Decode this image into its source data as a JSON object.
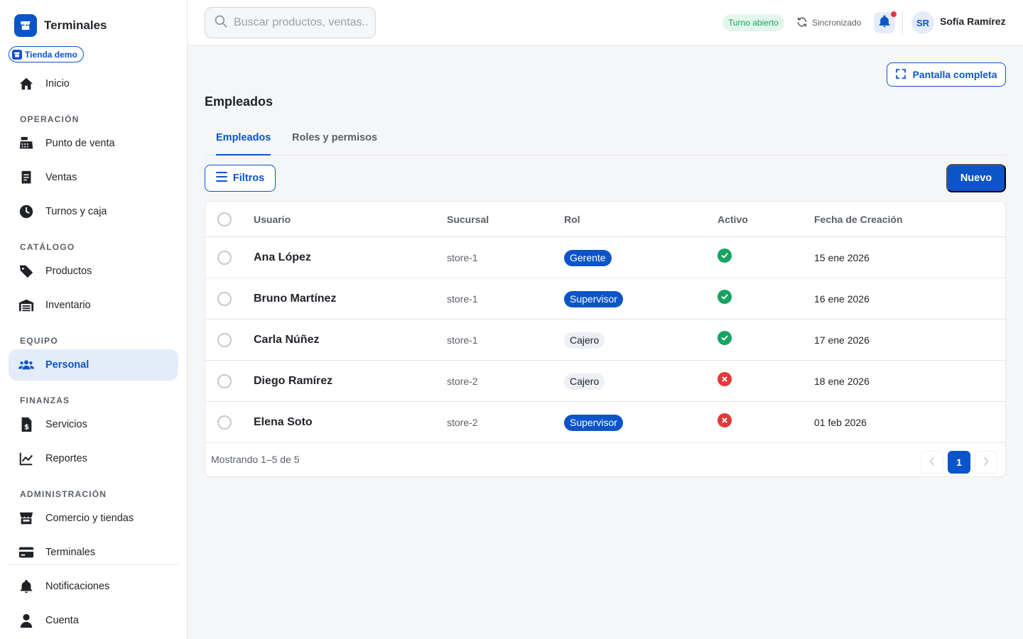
{
  "app": {
    "title": "Terminales",
    "store_badge": "Tienda demo"
  },
  "sidebar": {
    "home": "Inicio",
    "sections": {
      "operation": "OPERACIÓN",
      "catalog": "CATÁLOGO",
      "team": "EQUIPO",
      "finance": "FINANZAS",
      "admin": "ADMINISTRACIÓN"
    },
    "items": {
      "pos": "Punto de venta",
      "sales": "Ventas",
      "shifts": "Turnos y caja",
      "products": "Productos",
      "inventory": "Inventario",
      "staff": "Personal",
      "services": "Servicios",
      "reports": "Reportes",
      "commerce": "Comercio y tiendas",
      "terminals": "Terminales",
      "notifications": "Notificaciones",
      "account": "Cuenta"
    }
  },
  "header": {
    "search_placeholder": "Buscar productos, ventas...",
    "shift_status": "Turno abierto",
    "sync_status": "Sincronizado",
    "user_initials": "SR",
    "user_name": "Sofía Ramírez"
  },
  "main": {
    "fullscreen_label": "Pantalla completa",
    "page_title": "Empleados",
    "tabs": [
      "Empleados",
      "Roles y permisos"
    ],
    "filters_label": "Filtros",
    "new_label": "Nuevo",
    "columns": [
      "Usuario",
      "Sucursal",
      "Rol",
      "Activo",
      "Fecha de Creación"
    ],
    "rows": [
      {
        "user": "Ana López",
        "branch": "store-1",
        "role": "Gerente",
        "active": true,
        "created": "15 ene 2026"
      },
      {
        "user": "Bruno Martínez",
        "branch": "store-1",
        "role": "Supervisor",
        "active": true,
        "created": "16 ene 2026"
      },
      {
        "user": "Carla Núñez",
        "branch": "store-1",
        "role": "Cajero",
        "active": true,
        "created": "17 ene 2026"
      },
      {
        "user": "Diego Ramírez",
        "branch": "store-2",
        "role": "Cajero",
        "active": false,
        "created": "18 ene 2026"
      },
      {
        "user": "Elena Soto",
        "branch": "store-2",
        "role": "Supervisor",
        "active": false,
        "created": "01 feb 2026"
      }
    ],
    "footer_text": "Mostrando 1–5 de 5",
    "current_page": "1"
  },
  "colors": {
    "primary": "#0b55c9",
    "success": "#17a360",
    "danger": "#e5383b"
  }
}
